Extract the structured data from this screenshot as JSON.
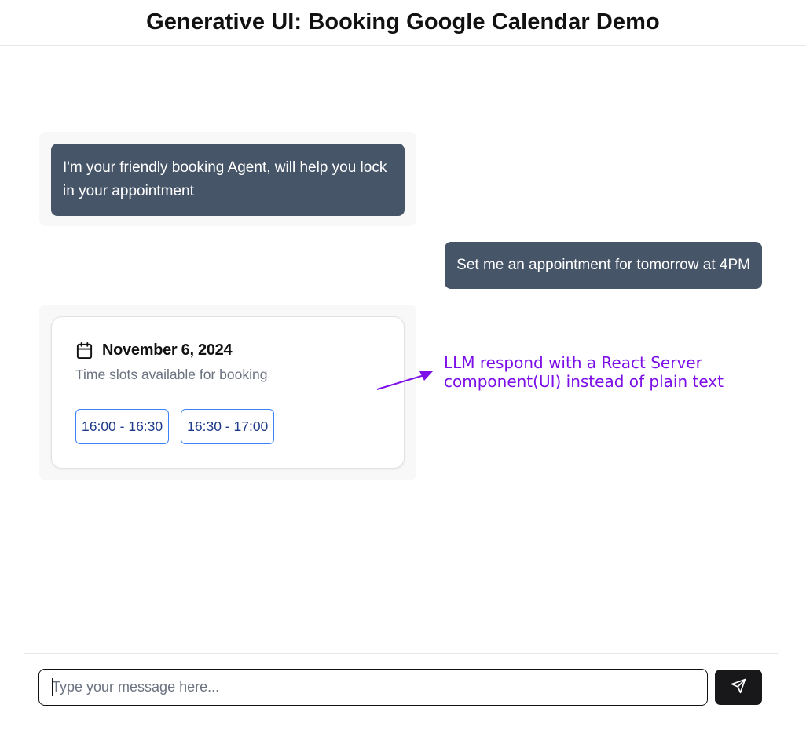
{
  "header": {
    "title": "Generative UI: Booking Google Calendar Demo"
  },
  "chat": {
    "messages": [
      {
        "role": "assistant",
        "text": "I'm your friendly booking Agent, will help you lock in your appointment"
      },
      {
        "role": "user",
        "text": "Set me an appointment for tomorrow at 4PM"
      }
    ],
    "booking_card": {
      "icon": "calendar-icon",
      "date": "November 6, 2024",
      "subtitle": "Time slots available for booking",
      "slots": [
        "16:00 - 16:30",
        "16:30 - 17:00"
      ]
    }
  },
  "annotation": {
    "line1": "LLM respond with a React Server",
    "line2": "component(UI) instead of plain text",
    "color": "#7c0ee8"
  },
  "composer": {
    "placeholder": "Type your message here...",
    "value": "",
    "send_icon": "send-icon"
  },
  "colors": {
    "bubble": "#475569",
    "slot_border": "#3b82f6",
    "send_button": "#18181b"
  }
}
